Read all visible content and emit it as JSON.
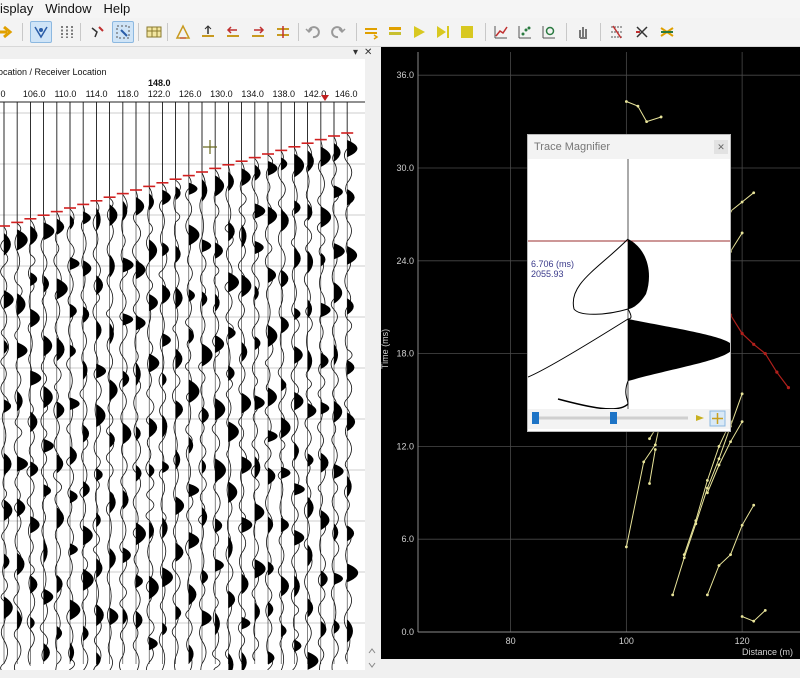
{
  "menubar": {
    "items": [
      "isplay",
      "Window",
      "Help"
    ]
  },
  "toolbar": {
    "buttons": [
      "arrow-right-icon",
      "pick-icon",
      "multi-pick-icon",
      "undo-pick-icon",
      "select-icon",
      "table-icon",
      "triangle-icon",
      "first-break-icon",
      "shift-left-icon",
      "shift-right-icon",
      "shift-up-down-icon",
      "undo-icon",
      "redo-icon",
      "layers-icon",
      "stack-icon",
      "play-icon",
      "play-end-icon",
      "stop-icon",
      "line-chart-icon",
      "scatter-chart-icon",
      "zoom-chart-icon",
      "hand-icon",
      "grid-select-icon",
      "crosshair-tool-icon",
      "shuffle-icon"
    ]
  },
  "gather": {
    "axis_label": "ocation / Receiver Location",
    "cursor_value": "148.0",
    "ticks": [
      "0",
      "106.0",
      "110.0",
      "114.0",
      "118.0",
      "122.0",
      "126.0",
      "130.0",
      "134.0",
      "138.0",
      "142.0",
      "146.0"
    ]
  },
  "chart_data": {
    "type": "scatter",
    "xlabel": "Distance (m)",
    "ylabel": "Time (ms)",
    "x_ticks": [
      "80",
      "100",
      "120"
    ],
    "y_ticks": [
      "0.0",
      "6.0",
      "12.0",
      "18.0",
      "24.0",
      "30.0",
      "36.0"
    ],
    "xlim": [
      64,
      130
    ],
    "ylim": [
      0,
      37.5
    ],
    "grid": true,
    "colors": {
      "series": "#e8e49a",
      "highlight": "#b0201c",
      "background": "#000000"
    },
    "series": [
      {
        "values": [
          [
            100,
            34.3
          ],
          [
            102,
            34
          ],
          [
            103.5,
            33
          ],
          [
            106,
            33.3
          ]
        ]
      },
      {
        "values": [
          [
            102,
            31.8
          ],
          [
            104,
            30.8
          ],
          [
            106,
            29.8
          ],
          [
            108,
            29
          ],
          [
            110,
            28.8
          ],
          [
            112,
            28
          ],
          [
            114,
            27.4
          ],
          [
            116,
            26.8
          ],
          [
            118,
            27.2
          ],
          [
            120,
            27.8
          ],
          [
            122,
            28.4
          ]
        ]
      },
      {
        "values": [
          [
            100,
            5.5
          ],
          [
            103,
            11
          ],
          [
            105,
            12.1
          ],
          [
            106.5,
            14.7
          ],
          [
            108,
            16.6
          ],
          [
            110,
            18.4
          ],
          [
            112,
            21
          ],
          [
            114,
            22.3
          ],
          [
            116,
            23.2
          ],
          [
            118,
            24.6
          ],
          [
            120,
            25.8
          ]
        ]
      },
      {
        "values": [
          [
            108,
            2.4
          ],
          [
            110,
            4.8
          ],
          [
            112,
            7
          ],
          [
            114,
            9.3
          ],
          [
            116,
            11.2
          ],
          [
            118,
            13.3
          ],
          [
            120,
            15.4
          ]
        ]
      },
      {
        "values": [
          [
            110,
            5
          ],
          [
            112,
            7.2
          ],
          [
            114,
            9.8
          ],
          [
            116,
            12
          ],
          [
            118,
            13.6
          ]
        ]
      },
      {
        "values": [
          [
            114,
            9
          ],
          [
            116,
            10.8
          ],
          [
            118,
            12.3
          ],
          [
            120,
            13.6
          ]
        ]
      },
      {
        "values": [
          [
            114,
            2.4
          ],
          [
            116,
            4.3
          ],
          [
            118,
            5
          ],
          [
            120,
            6.9
          ],
          [
            122,
            8.2
          ]
        ]
      },
      {
        "values": [
          [
            120,
            1
          ],
          [
            122,
            0.7
          ],
          [
            124,
            1.4
          ]
        ]
      },
      {
        "values": [
          [
            104,
            9.6
          ],
          [
            105,
            11.8
          ]
        ]
      },
      {
        "values": [
          [
            104,
            12.5
          ],
          [
            105.5,
            13.4
          ]
        ]
      }
    ],
    "highlight": [
      [
        116,
        22.3
      ],
      [
        118,
        20.5
      ],
      [
        120,
        19.3
      ],
      [
        122,
        18.6
      ],
      [
        124,
        18
      ],
      [
        126,
        16.8
      ],
      [
        128,
        15.8
      ]
    ]
  },
  "magnifier": {
    "title": "Trace Magnifier",
    "time_value": "6.706 (ms)",
    "amplitude_value": "2055.93"
  }
}
